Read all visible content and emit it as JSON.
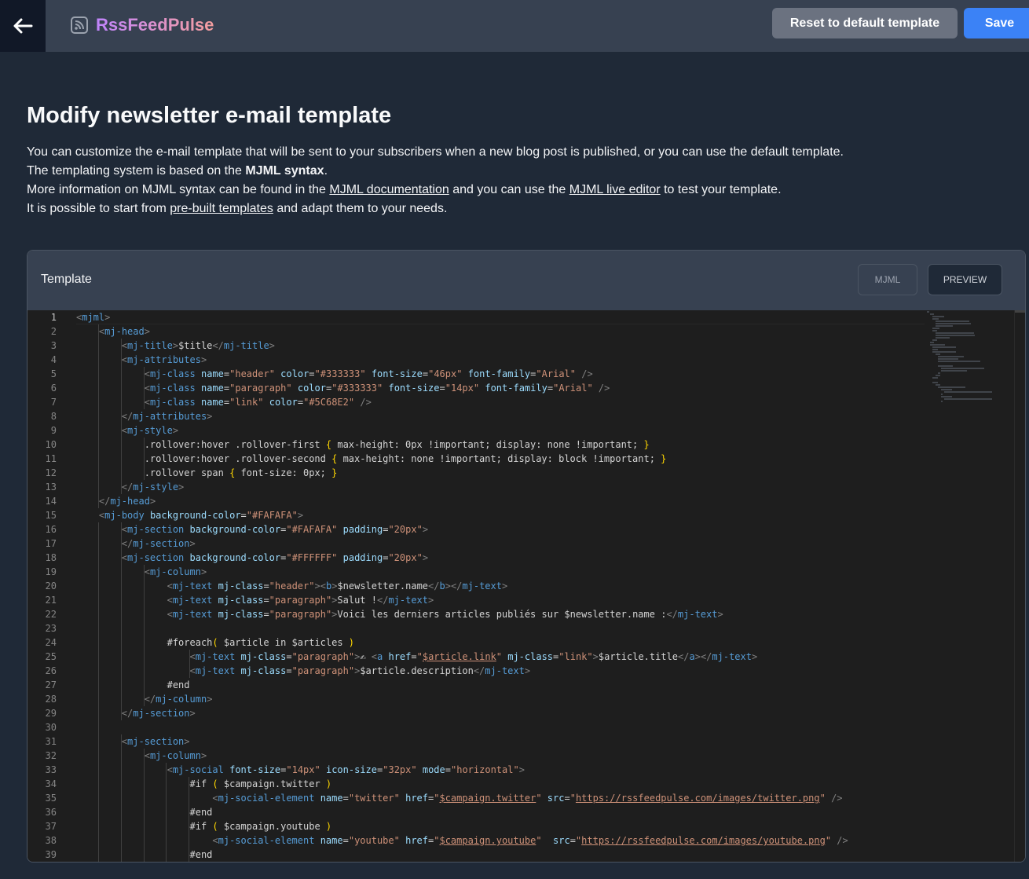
{
  "header": {
    "brand_name": "RssFeedPulse",
    "back_icon": "arrow-left-icon",
    "rss_icon": "rss-icon",
    "reset_label": "Reset to default template",
    "save_label": "Save",
    "save_color": "#3b82f6",
    "reset_color": "#6b7280"
  },
  "page": {
    "title": "Modify newsletter e-mail template",
    "line1": "You can customize the e-mail template that will be sent to your subscribers when a new blog post is published, or you can use the default template.",
    "line2_prefix": "The templating system is based on the ",
    "line2_bold": "MJML syntax",
    "line2_suffix": ".",
    "line3_prefix": "More information on MJML syntax can be found in the ",
    "line3_link1": "MJML documentation",
    "line3_mid": " and you can use the ",
    "line3_link2": "MJML live editor",
    "line3_suffix": " to test your template.",
    "line4_prefix": "It is possible to start from ",
    "line4_link": "pre-built templates",
    "line4_suffix": " and adapt them to your needs."
  },
  "panel": {
    "title": "Template",
    "tab_mjml": "MJML",
    "tab_preview": "PREVIEW",
    "active_tab": "PREVIEW"
  },
  "editor": {
    "active_line": 1,
    "lines": [
      "<mjml>",
      "    <mj-head>",
      "        <mj-title>$title</mj-title>",
      "        <mj-attributes>",
      "            <mj-class name=\"header\" color=\"#333333\" font-size=\"46px\" font-family=\"Arial\" />",
      "            <mj-class name=\"paragraph\" color=\"#333333\" font-size=\"14px\" font-family=\"Arial\" />",
      "            <mj-class name=\"link\" color=\"#5C68E2\" />",
      "        </mj-attributes>",
      "        <mj-style>",
      "            .rollover:hover .rollover-first { max-height: 0px !important; display: none !important; }",
      "            .rollover:hover .rollover-second { max-height: none !important; display: block !important; }",
      "            .rollover span { font-size: 0px; }",
      "        </mj-style>",
      "    </mj-head>",
      "    <mj-body background-color=\"#FAFAFA\">",
      "        <mj-section background-color=\"#FAFAFA\" padding=\"20px\">",
      "        </mj-section>",
      "        <mj-section background-color=\"#FFFFFF\" padding=\"20px\">",
      "            <mj-column>",
      "                <mj-text mj-class=\"header\"><b>$newsletter.name</b></mj-text>",
      "                <mj-text mj-class=\"paragraph\">Salut !</mj-text>",
      "                <mj-text mj-class=\"paragraph\">Voici les derniers articles publiés sur $newsletter.name :</mj-text>",
      "",
      "                #foreach( $article in $articles )",
      "                    <mj-text mj-class=\"paragraph\">✍ <a href=\"$article.link\" mj-class=\"link\">$article.title</a></mj-text>",
      "                    <mj-text mj-class=\"paragraph\">$article.description</mj-text>",
      "                #end",
      "            </mj-column>",
      "        </mj-section>",
      "",
      "        <mj-section>",
      "            <mj-column>",
      "                <mj-social font-size=\"14px\" icon-size=\"32px\" mode=\"horizontal\">",
      "                    #if ( $campaign.twitter )",
      "                        <mj-social-element name=\"twitter\" href=\"$campaign.twitter\" src=\"https://rssfeedpulse.com/images/twitter.png\" />",
      "                    #end",
      "                    #if ( $campaign.youtube )",
      "                        <mj-social-element name=\"youtube\" href=\"$campaign.youtube\"  src=\"https://rssfeedpulse.com/images/youtube.png\" />",
      "                    #end"
    ]
  }
}
